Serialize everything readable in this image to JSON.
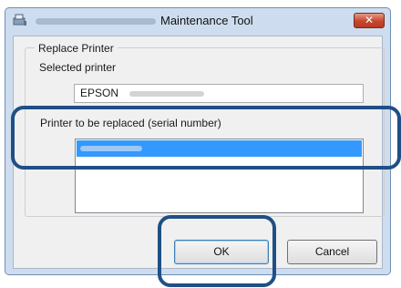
{
  "window": {
    "title": "Maintenance Tool",
    "close_glyph": "✕"
  },
  "group": {
    "legend": "Replace Printer",
    "selected_label": "Selected printer",
    "selected_value": "EPSON",
    "replaced_label": "Printer to be replaced (serial number)"
  },
  "buttons": {
    "ok": "OK",
    "cancel": "Cancel"
  },
  "colors": {
    "selection": "#3399ff",
    "highlight_ring": "#1f4f86",
    "close_button": "#c74530"
  },
  "icons": [
    "app-icon",
    "close-icon"
  ]
}
